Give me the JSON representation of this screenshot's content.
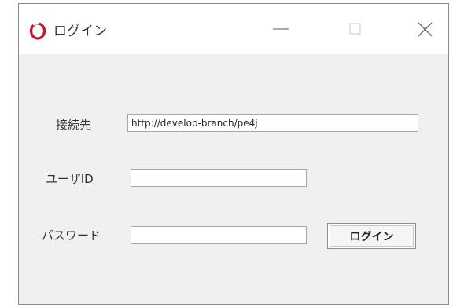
{
  "window": {
    "title": "ログイン",
    "icon": "app-logo-icon",
    "controls": {
      "minimize_icon": "minimize-icon",
      "maximize_icon": "maximize-icon",
      "close_icon": "close-icon"
    },
    "accent_color": "#c8102e"
  },
  "form": {
    "server": {
      "label": "接続先",
      "value": "http://develop-branch/pe4j"
    },
    "user_id": {
      "label": "ユーザID",
      "value": ""
    },
    "password": {
      "label": "パスワード",
      "value": ""
    },
    "login_button": {
      "label": "ログイン"
    }
  }
}
